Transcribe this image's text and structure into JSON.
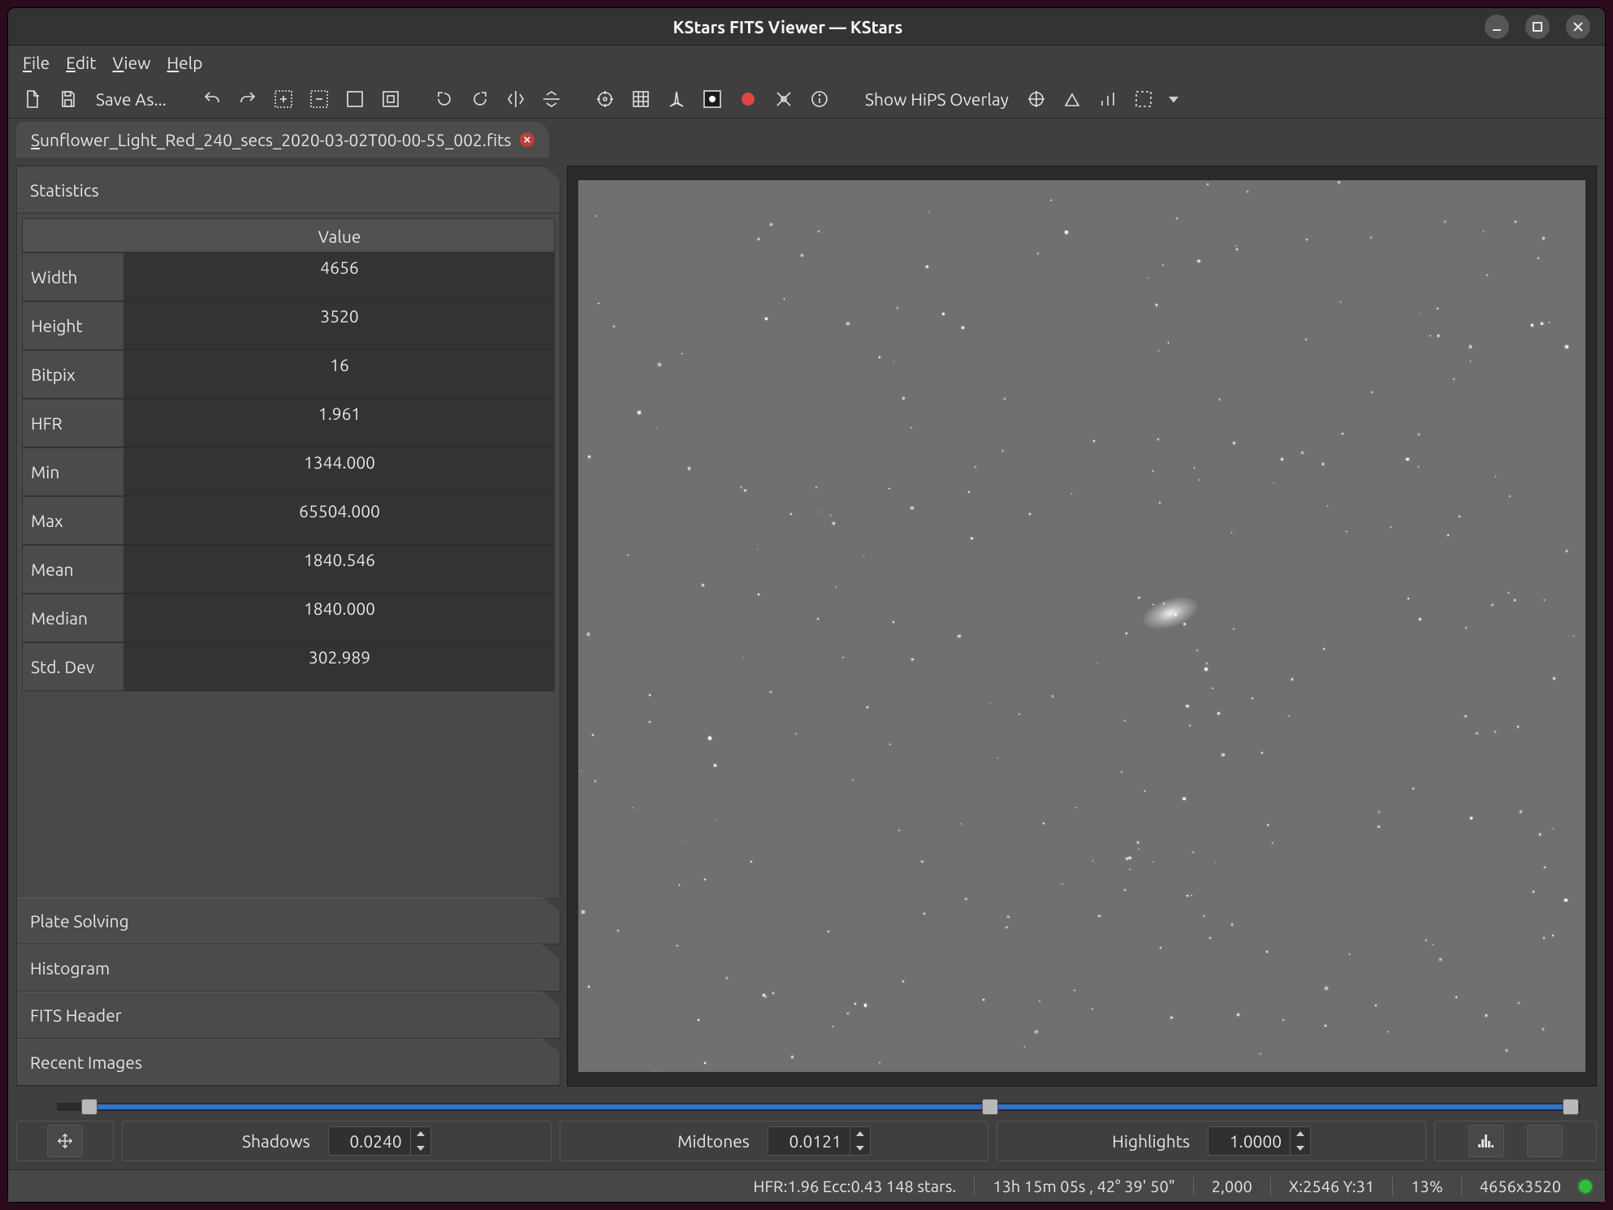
{
  "window": {
    "title": "KStars FITS Viewer — KStars"
  },
  "menu": {
    "file": "File",
    "edit": "Edit",
    "view": "View",
    "help": "Help"
  },
  "toolbar": {
    "save_as": "Save As...",
    "hips_overlay": "Show HiPS Overlay"
  },
  "tab": {
    "label": "Sunflower_Light_Red_240_secs_2020-03-02T00-00-55_002.fits"
  },
  "sidebar": {
    "statistics": "Statistics",
    "plate_solving": "Plate Solving",
    "histogram": "Histogram",
    "fits_header": "FITS Header",
    "recent_images": "Recent Images",
    "value_header": "Value",
    "rows": [
      {
        "label": "Width",
        "value": "4656"
      },
      {
        "label": "Height",
        "value": "3520"
      },
      {
        "label": "Bitpix",
        "value": "16"
      },
      {
        "label": "HFR",
        "value": "1.961"
      },
      {
        "label": "Min",
        "value": "1344.000"
      },
      {
        "label": "Max",
        "value": "65504.000"
      },
      {
        "label": "Mean",
        "value": "1840.546"
      },
      {
        "label": "Median",
        "value": "1840.000"
      },
      {
        "label": "Std. Dev",
        "value": "302.989"
      }
    ]
  },
  "stretch": {
    "shadows_label": "Shadows",
    "shadows": "0.0240",
    "midtones_label": "Midtones",
    "midtones": "0.0121",
    "highlights_label": "Highlights",
    "highlights": "1.0000"
  },
  "status": {
    "hfr": "HFR:1.96 Ecc:0.43 148 stars.",
    "coords": "13h 15m 05s ,  42° 39' 50\"",
    "pix_value": "2,000",
    "xy": "X:2546 Y:31",
    "zoom": "13%",
    "dims": "4656x3520"
  }
}
